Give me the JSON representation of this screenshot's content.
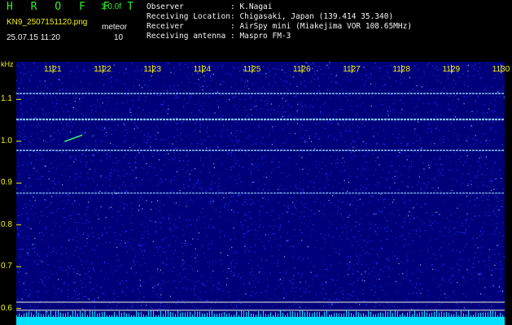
{
  "header": {
    "logo": "HROFFT",
    "version": "1.0.0f",
    "file_name": "KN9_2507151120.png",
    "mode": "meteor",
    "datetime": "25.07.15 11:20",
    "count": "10",
    "info": [
      {
        "key": "Observer",
        "value": ": K.Nagai"
      },
      {
        "key": "Receiving Location",
        "value": ": Chigasaki, Japan (139.414 35.340)"
      },
      {
        "key": "Receiver",
        "value": ": AirSpy mini (Miakejima VOR 108.65MHz)"
      },
      {
        "key": "Receiving antenna",
        "value": ": Maspro FM-3"
      }
    ]
  },
  "colors": {
    "background": "#00007a",
    "noise": "#1e3cff",
    "lines": "#9ad8ff",
    "labels": "#f2f20f",
    "header_text": "#2ef02e",
    "info_text": "#f4f4f4",
    "bottom_band": "#00e0ff"
  },
  "chart_data": {
    "type": "heatmap",
    "title": "",
    "xlabel": "",
    "ylabel": "kHz",
    "x_ticks": [
      "1121",
      "1122",
      "1123",
      "1124",
      "1125",
      "1126",
      "1127",
      "1128",
      "1129",
      "1130"
    ],
    "y_ticks": [
      "1.1",
      "1.0",
      "0.9",
      "0.8",
      "0.7",
      "0.6"
    ],
    "ylim": [
      0.58,
      1.19
    ],
    "horizontal_lines_khz": [
      1.114,
      1.052,
      0.978,
      0.876,
      0.615,
      0.596
    ],
    "meteor_echo": {
      "time": "1122",
      "khz": 1.005
    }
  }
}
